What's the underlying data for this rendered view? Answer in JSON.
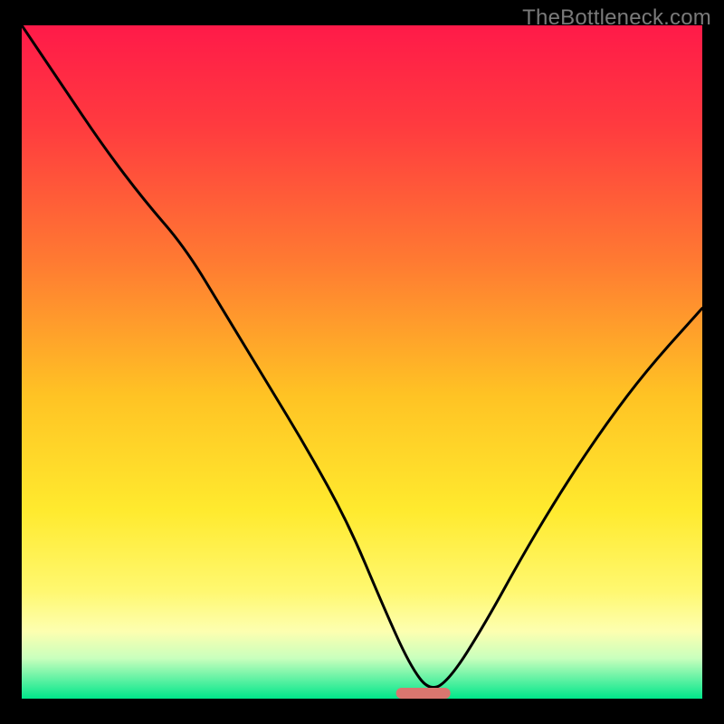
{
  "watermark": "TheBottleneck.com",
  "chart_data": {
    "type": "line",
    "title": "",
    "xlabel": "",
    "ylabel": "",
    "xlim": [
      0,
      100
    ],
    "ylim": [
      0,
      100
    ],
    "x": [
      0,
      6,
      12,
      18,
      24,
      30,
      36,
      42,
      48,
      53,
      57,
      60,
      63,
      68,
      74,
      80,
      86,
      92,
      100
    ],
    "values": [
      100,
      91,
      82,
      74,
      67,
      57,
      47,
      37,
      26,
      14,
      5,
      1,
      3,
      11,
      22,
      32,
      41,
      49,
      58
    ],
    "series_name": "bottleneck-curve",
    "marker": {
      "x_start": 55,
      "x_end": 63,
      "y": 0,
      "color": "#d9766f"
    },
    "gradient_stops": [
      {
        "offset": 0.0,
        "color": "#ff1a49"
      },
      {
        "offset": 0.15,
        "color": "#ff3b3f"
      },
      {
        "offset": 0.35,
        "color": "#ff7a32"
      },
      {
        "offset": 0.55,
        "color": "#ffc324"
      },
      {
        "offset": 0.72,
        "color": "#ffea2e"
      },
      {
        "offset": 0.84,
        "color": "#fff870"
      },
      {
        "offset": 0.9,
        "color": "#fdffb0"
      },
      {
        "offset": 0.94,
        "color": "#c9ffbd"
      },
      {
        "offset": 0.975,
        "color": "#53f0a0"
      },
      {
        "offset": 1.0,
        "color": "#00e78a"
      }
    ]
  }
}
